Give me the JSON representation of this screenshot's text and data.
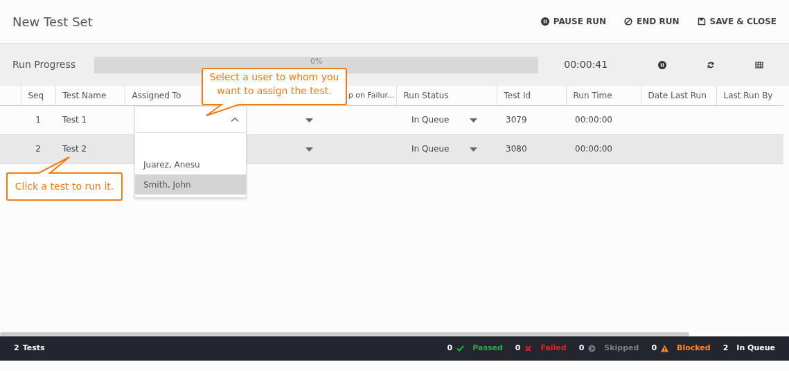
{
  "window": {
    "title": "New Test Set"
  },
  "actions": [
    {
      "label": "PAUSE RUN",
      "kind": "pause"
    },
    {
      "label": "END RUN",
      "kind": "end"
    },
    {
      "label": "SAVE & CLOSE",
      "kind": "save"
    }
  ],
  "progress": {
    "label": "Run Progress",
    "level": 0,
    "reading": "0%",
    "time": "00:00:41"
  },
  "progress_tools": [
    {
      "kind": "pause"
    },
    {
      "kind": "refresh"
    },
    {
      "kind": "grid"
    }
  ],
  "table": {
    "columns": [
      "Seq",
      "Test Name",
      "Assigned To",
      "p on Failur...",
      "Run Status",
      "Test Id",
      "Run Time",
      "Date Last Run",
      "Last Run By"
    ],
    "rows": [
      {
        "seq": "1",
        "name": "Test 1",
        "run_status": "In Queue",
        "test_id": "3079",
        "run_time": "00:00:00",
        "selected": false
      },
      {
        "seq": "2",
        "name": "Test 2",
        "run_status": "In Queue",
        "test_id": "3080",
        "run_time": "00:00:00",
        "selected": true
      }
    ]
  },
  "assign_dropdown": {
    "expanded": true,
    "options": [
      {
        "label": "Juarez, Anesu",
        "selected": false
      },
      {
        "label": "Smith, John",
        "selected": true
      }
    ]
  },
  "callouts": [
    {
      "text": "Select a user to whom you want to assign the test.",
      "kind": "down"
    },
    {
      "text": "Click a test to run it.",
      "kind": "up"
    }
  ],
  "status_bar": {
    "count": "2",
    "label": "Tests",
    "stats": [
      {
        "count": "0",
        "label": "Passed",
        "kind": "passed",
        "color": "#22b14c"
      },
      {
        "count": "0",
        "label": "Failed",
        "kind": "failed",
        "color": "#ff1a1a"
      },
      {
        "count": "0",
        "label": "Skipped",
        "kind": "skipped",
        "color": "#808080"
      },
      {
        "count": "0",
        "label": "Blocked",
        "kind": "blocked",
        "color": "#ff8c1a"
      },
      {
        "count": "2",
        "label": "In Queue",
        "kind": "queue",
        "color": "#ffffff"
      }
    ]
  }
}
